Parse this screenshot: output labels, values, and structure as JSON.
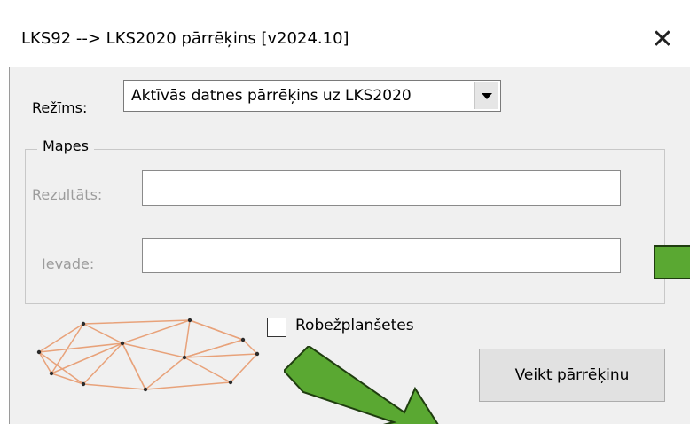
{
  "window": {
    "title": "LKS92 --> LKS2020 pārrēķins [v2024.10]",
    "close_glyph": "✕"
  },
  "mode": {
    "label": "Režīms:",
    "selected": "Aktīvās datnes pārrēķins uz LKS2020"
  },
  "folders": {
    "group_title": "Mapes",
    "result_label": "Rezultāts:",
    "result_value": "",
    "input_label": "Ievade:",
    "input_value": ""
  },
  "options": {
    "border_sheets_label": "Robežplanšetes",
    "border_sheets_checked": false
  },
  "actions": {
    "run_label": "Veikt pārrēķinu"
  },
  "icons": {
    "logo": "triangulation-network-icon",
    "annotation_arrow_right": "green-arrow-icon",
    "annotation_arrow_diagonal": "green-arrow-icon"
  },
  "colors": {
    "annotation_green": "#5aa832",
    "annotation_outline": "#1f3d0f",
    "logo_lines": "#e8a27a",
    "logo_nodes": "#2b2b2b"
  }
}
